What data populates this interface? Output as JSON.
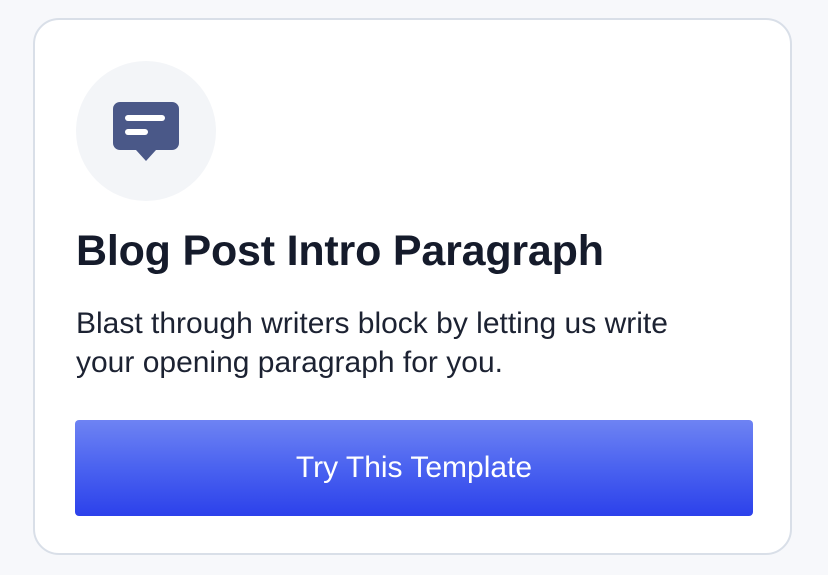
{
  "card": {
    "icon": "chat-bubble-icon",
    "title": "Blog Post Intro Paragraph",
    "description": "Blast through writers block by letting us write your opening paragraph for you.",
    "button_label": "Try This Template"
  },
  "colors": {
    "icon": "#4a5888",
    "button_top": "#6e83f3",
    "button_bottom": "#2c41eb",
    "title": "#151b2b"
  }
}
